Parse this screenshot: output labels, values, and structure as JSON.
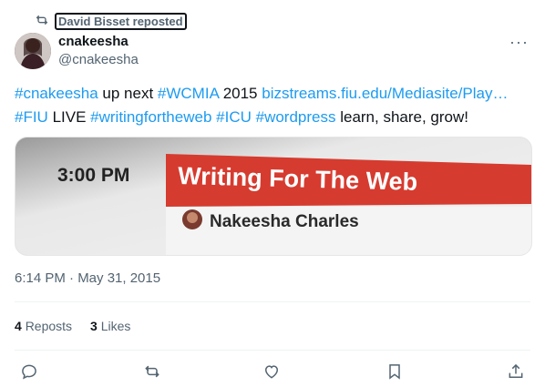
{
  "repost": {
    "label": "David Bisset reposted"
  },
  "author": {
    "name": "cnakeesha",
    "handle": "@cnakeesha"
  },
  "more_label": "···",
  "tweet": {
    "line1": [
      {
        "text": "#cnakeesha",
        "link": true
      },
      {
        "text": " up next ",
        "link": false
      },
      {
        "text": "#WCMIA",
        "link": true
      },
      {
        "text": " 2015 ",
        "link": false
      },
      {
        "text": "bizstreams.fiu.edu/Mediasite/Play…",
        "link": true
      }
    ],
    "line2": [
      {
        "text": "#FIU",
        "link": true
      },
      {
        "text": " LIVE ",
        "link": false
      },
      {
        "text": "#writingfortheweb",
        "link": true
      },
      {
        "text": " ",
        "link": false
      },
      {
        "text": "#ICU",
        "link": true
      },
      {
        "text": " ",
        "link": false
      },
      {
        "text": "#wordpress",
        "link": true
      },
      {
        "text": " learn, share, grow!",
        "link": false
      }
    ]
  },
  "media": {
    "time_text": "3:00 PM",
    "session_title": "Writing For The Web",
    "speaker": "Nakeesha Charles",
    "colors": {
      "banner": "#d63b2f",
      "background": "#d9d9d9"
    }
  },
  "timestamp": "6:14 PM · May 31, 2015",
  "stats": {
    "reposts_count": "4",
    "reposts_label": "Reposts",
    "likes_count": "3",
    "likes_label": "Likes"
  },
  "actions": [
    "reply-icon",
    "repost-icon",
    "like-icon",
    "bookmark-icon",
    "share-icon"
  ],
  "colors": {
    "link": "#1d9bf0",
    "muted": "#536471",
    "text": "#0f1419"
  }
}
